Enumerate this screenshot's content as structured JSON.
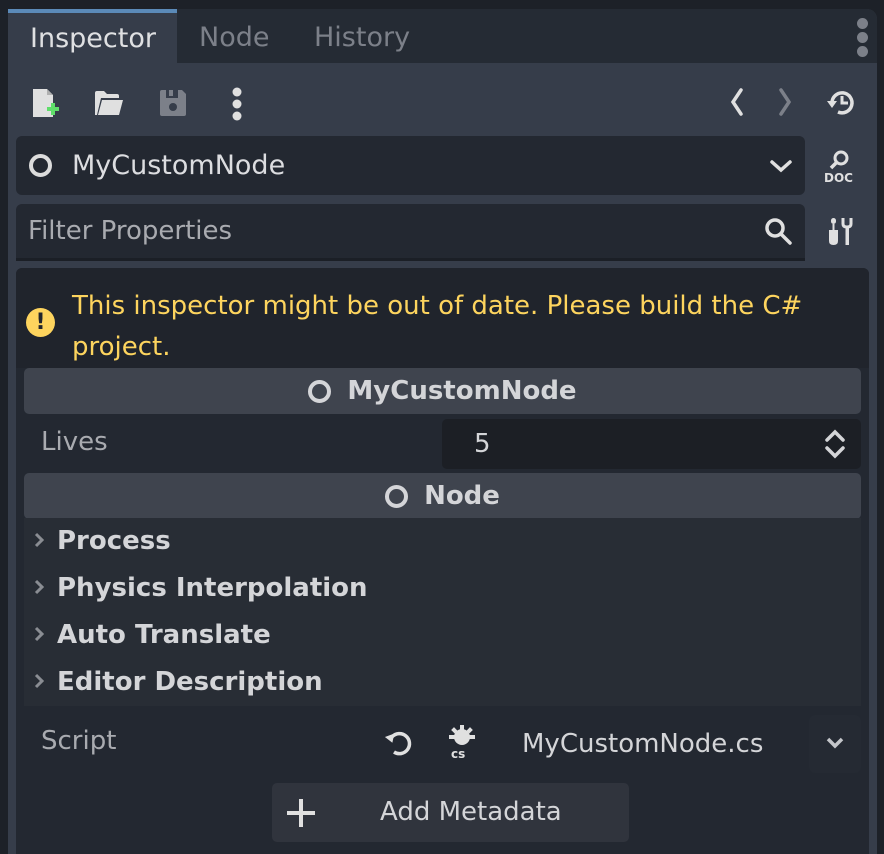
{
  "tabs": [
    {
      "label": "Inspector",
      "active": true
    },
    {
      "label": "Node",
      "active": false
    },
    {
      "label": "History",
      "active": false
    }
  ],
  "toolbar": {
    "icons": [
      "new-resource-icon",
      "open-folder-icon",
      "save-icon",
      "more-options-icon",
      "back-icon",
      "forward-icon",
      "history-icon"
    ]
  },
  "object_selector": {
    "name": "MyCustomNode",
    "icon": "node-circle-icon"
  },
  "filter": {
    "placeholder": "Filter Properties",
    "value": ""
  },
  "warning": {
    "text": "This inspector might be out of date. Please build the C# project.",
    "color": "#fdd45e"
  },
  "sections": {
    "custom": {
      "title": "MyCustomNode",
      "properties": [
        {
          "label": "Lives",
          "value": "5"
        }
      ]
    },
    "node": {
      "title": "Node",
      "groups": [
        "Process",
        "Physics Interpolation",
        "Auto Translate",
        "Editor Description"
      ]
    }
  },
  "script": {
    "label": "Script",
    "file": "MyCustomNode.cs"
  },
  "add_metadata": {
    "label": "Add Metadata"
  },
  "colors": {
    "accent": "#5b8ab8",
    "warning": "#fdd45e",
    "new_icon_plus": "#5fde6a"
  }
}
